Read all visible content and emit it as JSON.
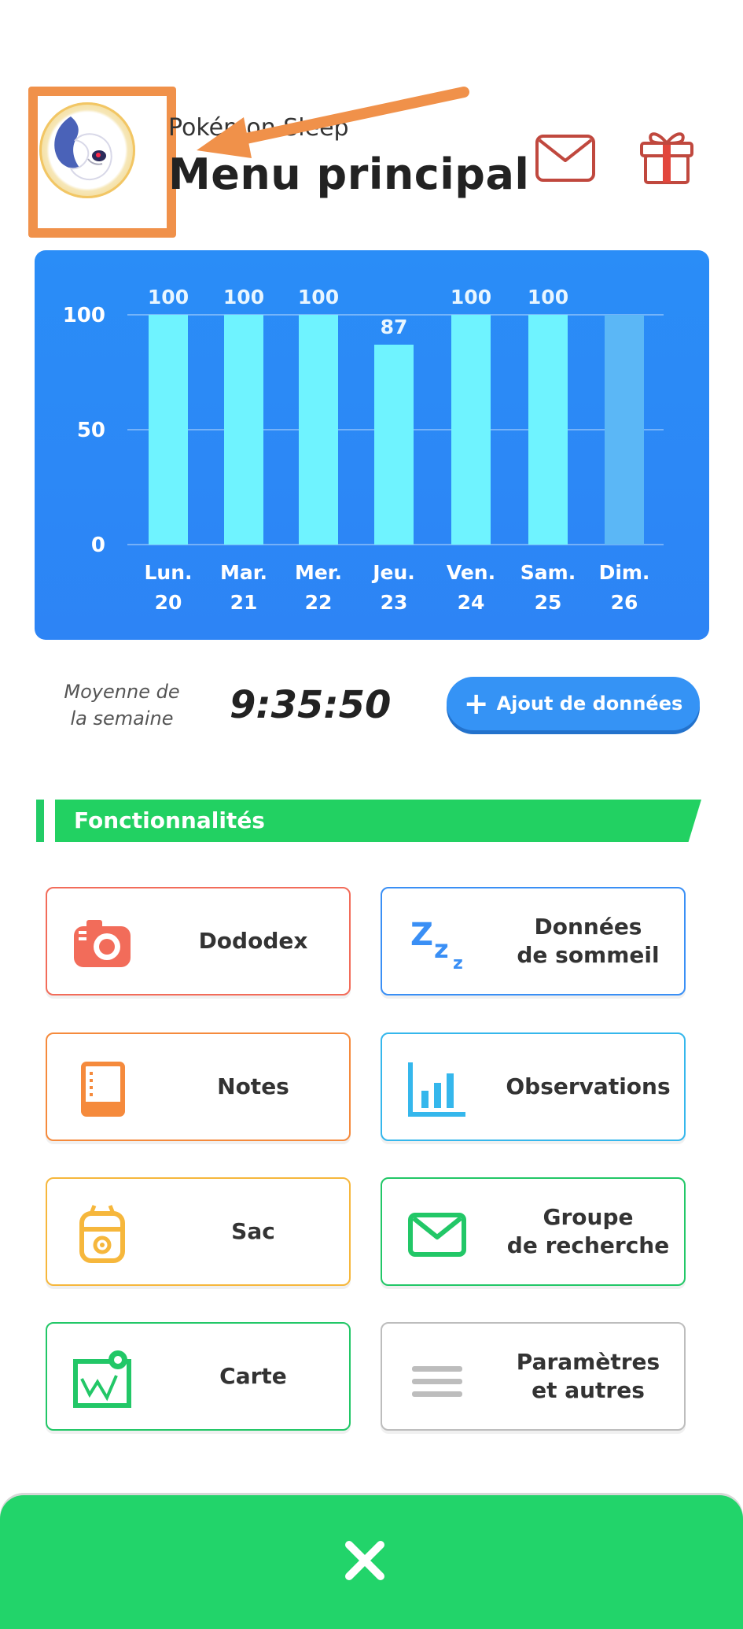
{
  "header": {
    "app_name": "Pokémon Sleep",
    "title": "Menu principal",
    "avatar_icon": "pokemon-avatar-icon",
    "mail_icon": "mail-icon",
    "gift_icon": "gift-icon",
    "annotation_color": "#f0914a"
  },
  "chart_data": {
    "type": "bar",
    "categories": [
      "Lun.\n20",
      "Mar.\n21",
      "Mer.\n22",
      "Jeu.\n23",
      "Ven.\n24",
      "Sam.\n25",
      "Dim.\n26"
    ],
    "day_names": [
      "Lun.",
      "Mar.",
      "Mer.",
      "Jeu.",
      "Ven.",
      "Sam.",
      "Dim."
    ],
    "day_numbers": [
      "20",
      "21",
      "22",
      "23",
      "24",
      "25",
      "26"
    ],
    "values": [
      100,
      100,
      100,
      87,
      100,
      100,
      null
    ],
    "value_labels": [
      "100",
      "100",
      "100",
      "87",
      "100",
      "100",
      ""
    ],
    "ylim": [
      0,
      100
    ],
    "yticks": [
      "0",
      "50",
      "100"
    ],
    "grid": true,
    "colors": {
      "background": "#2d88f6",
      "bar": "#6ff3ff",
      "bar_pending": "#5bb7f6"
    }
  },
  "summary": {
    "avg_label": "Moyenne de\nla semaine",
    "avg_value": "9:35:50",
    "add_button": "Ajout de données"
  },
  "features": {
    "title": "Fonctionnalités",
    "accent": "#22d162",
    "tiles": [
      {
        "label": "Dododex",
        "icon": "camera-icon",
        "color": "#f26c5a"
      },
      {
        "label": "Données\nde sommeil",
        "icon": "zzz-icon",
        "color": "#3a8ff5"
      },
      {
        "label": "Notes",
        "icon": "notebook-icon",
        "color": "#f58a3c"
      },
      {
        "label": "Observations",
        "icon": "bar-chart-icon",
        "color": "#35b7ec"
      },
      {
        "label": "Sac",
        "icon": "backpack-icon",
        "color": "#f6b73c"
      },
      {
        "label": "Groupe\nde recherche",
        "icon": "envelope-icon",
        "color": "#22c767"
      },
      {
        "label": "Carte",
        "icon": "map-icon",
        "color": "#22c767"
      },
      {
        "label": "Paramètres\net autres",
        "icon": "menu-icon",
        "color": "#bdbdbd"
      }
    ]
  },
  "bottom": {
    "close_icon": "close-icon"
  }
}
